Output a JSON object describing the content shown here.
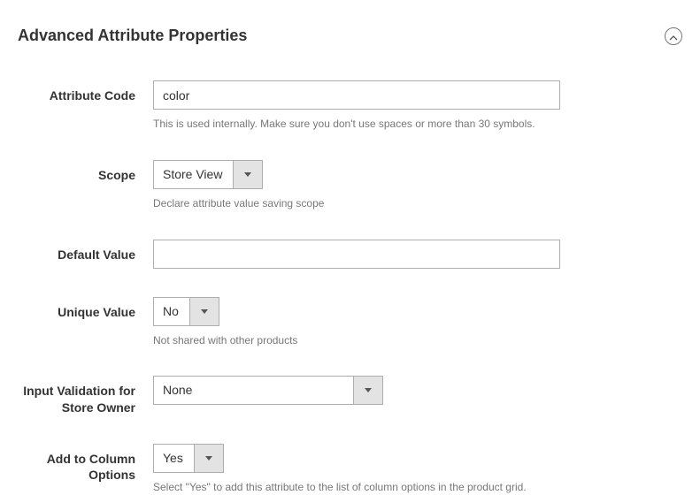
{
  "section": {
    "title": "Advanced Attribute Properties"
  },
  "fields": {
    "attribute_code": {
      "label": "Attribute Code",
      "value": "color",
      "help": "This is used internally. Make sure you don't use spaces or more than 30 symbols."
    },
    "scope": {
      "label": "Scope",
      "value": "Store View",
      "help": "Declare attribute value saving scope"
    },
    "default_value": {
      "label": "Default Value",
      "value": ""
    },
    "unique_value": {
      "label": "Unique Value",
      "value": "No",
      "help": "Not shared with other products"
    },
    "input_validation": {
      "label": "Input Validation for Store Owner",
      "value": "None"
    },
    "add_to_column": {
      "label": "Add to Column Options",
      "value": "Yes",
      "help": "Select \"Yes\" to add this attribute to the list of column options in the product grid."
    }
  }
}
